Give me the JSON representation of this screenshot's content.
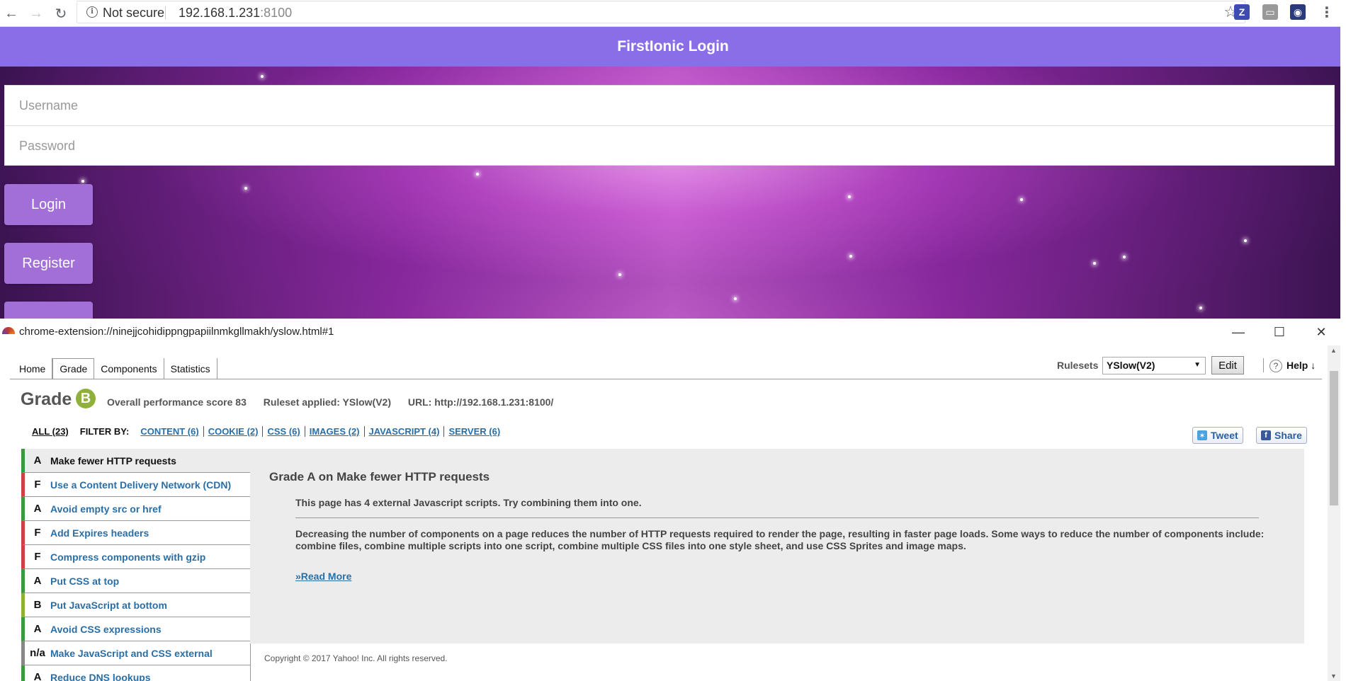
{
  "browser": {
    "security_label": "Not secure",
    "url_host": "192.168.1.231",
    "url_port": ":8100",
    "info_icon": "i",
    "ext1_letter": "Z"
  },
  "app": {
    "header_title": "FirstIonic Login",
    "username_placeholder": "Username",
    "password_placeholder": "Password",
    "login_label": "Login",
    "register_label": "Register"
  },
  "popup": {
    "title": "chrome-extension://ninejjcohidippngpapiilnmkgllmakh/yslow.html#1"
  },
  "yslow": {
    "tabs": [
      "Home",
      "Grade",
      "Components",
      "Statistics"
    ],
    "rulesets_label": "Rulesets",
    "ruleset_selected": "YSlow(V2)",
    "edit_label": "Edit",
    "help_q": "?",
    "help_label": "Help ↓",
    "grade_title": "Grade",
    "grade_letter": "B",
    "score_text": "Overall performance score 83",
    "ruleset_applied": "Ruleset applied: YSlow(V2)",
    "url_text": "URL: http://192.168.1.231:8100/",
    "filter_all": "ALL (23)",
    "filter_by": "FILTER BY:",
    "filters": [
      "CONTENT (6)",
      "COOKIE (2)",
      "CSS (6)",
      "IMAGES (2)",
      "JAVASCRIPT (4)",
      "SERVER (6)"
    ],
    "tweet_label": "Tweet",
    "share_label": "Share",
    "rules": [
      {
        "grade": "A",
        "title": "Make fewer HTTP requests",
        "color": "#3a9a3a"
      },
      {
        "grade": "F",
        "title": "Use a Content Delivery Network (CDN)",
        "color": "#d04040"
      },
      {
        "grade": "A",
        "title": "Avoid empty src or href",
        "color": "#3a9a3a"
      },
      {
        "grade": "F",
        "title": "Add Expires headers",
        "color": "#d04040"
      },
      {
        "grade": "F",
        "title": "Compress components with gzip",
        "color": "#d04040"
      },
      {
        "grade": "A",
        "title": "Put CSS at top",
        "color": "#3a9a3a"
      },
      {
        "grade": "B",
        "title": "Put JavaScript at bottom",
        "color": "#8fb03a"
      },
      {
        "grade": "A",
        "title": "Avoid CSS expressions",
        "color": "#3a9a3a"
      },
      {
        "grade": "n/a",
        "title": "Make JavaScript and CSS external",
        "color": "#888888"
      },
      {
        "grade": "A",
        "title": "Reduce DNS lookups",
        "color": "#3a9a3a"
      }
    ],
    "detail": {
      "title": "Grade A on Make fewer HTTP requests",
      "message": "This page has 4 external Javascript scripts. Try combining them into one.",
      "description": "Decreasing the number of components on a page reduces the number of HTTP requests required to render the page, resulting in faster page loads. Some ways to reduce the number of components include: combine files, combine multiple scripts into one script, combine multiple CSS files into one style sheet, and use CSS Sprites and image maps.",
      "read_more": "»Read More"
    },
    "copyright": "Copyright © 2017 Yahoo! Inc. All rights reserved."
  }
}
